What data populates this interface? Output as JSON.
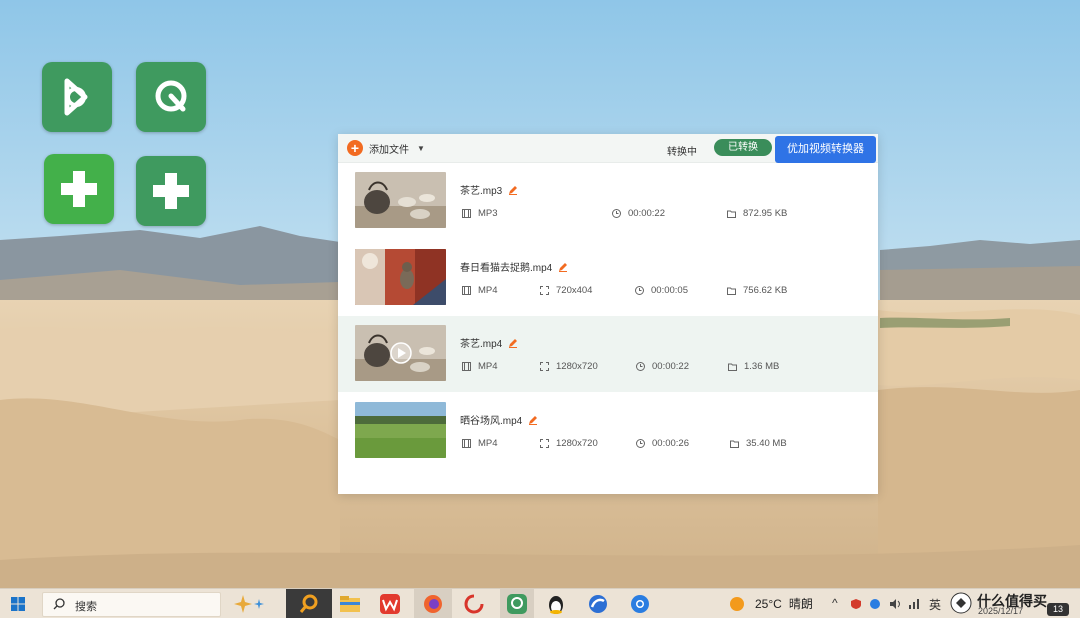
{
  "toolbar": {
    "add_file_label": "添加文件",
    "tab_converting": "转换中",
    "tab_converted": "已转换",
    "primary_button": "优加视频转换器"
  },
  "files": [
    {
      "name": "茶艺.mp3",
      "format": "MP3",
      "resolution": "",
      "duration": "00:00:22",
      "size": "872.95 KB",
      "thumbnail": "teapot-tea-set"
    },
    {
      "name": "春日看猫去捉鹅.mp4",
      "format": "MP4",
      "resolution": "720x404",
      "duration": "00:00:05",
      "size": "756.62 KB",
      "thumbnail": "cat-red-wall"
    },
    {
      "name": "茶艺.mp4",
      "format": "MP4",
      "resolution": "1280x720",
      "duration": "00:00:22",
      "size": "1.36 MB",
      "thumbnail": "teapot-tea-set-play"
    },
    {
      "name": "晒谷场风.mp4",
      "format": "MP4",
      "resolution": "1280x720",
      "duration": "00:00:26",
      "size": "35.40 MB",
      "thumbnail": "green-field"
    }
  ],
  "taskbar": {
    "search_placeholder": "搜索",
    "weather_temp": "25°C",
    "weather_desc": "晴朗",
    "ime": "英",
    "date": "2025/12/17",
    "notification_count": "13",
    "watermark": "什么值得买"
  },
  "colors": {
    "accent_orange": "#f26b21",
    "tab_active_green": "#3a8d5a",
    "primary_blue": "#2f73e6",
    "desktop_icon_green": "#3f9a5f"
  }
}
